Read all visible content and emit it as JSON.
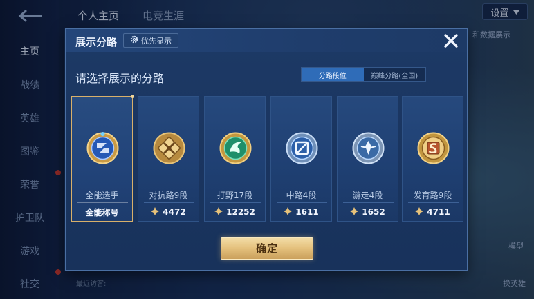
{
  "background": {
    "top_tabs": [
      "个人主页",
      "电竞生涯"
    ],
    "settings_label": "设置",
    "sidebar": [
      "主页",
      "战绩",
      "英雄",
      "图鉴",
      "荣誉",
      "护卫队",
      "游戏",
      "社交"
    ],
    "right_labels": [
      "模型",
      "换英雄"
    ],
    "bottom_label": "最近访客:",
    "partial_text": "和数据展示"
  },
  "modal": {
    "title": "展示分路",
    "priority_button": "优先显示",
    "subtitle": "请选择展示的分路",
    "tabs": [
      {
        "label": "分路段位",
        "active": true
      },
      {
        "label": "巅峰分路(全国)",
        "active": false
      }
    ],
    "cards": [
      {
        "rank": "全能选手",
        "value": "全能称号",
        "selected": true,
        "icon": "all-round-emblem"
      },
      {
        "rank": "对抗路9段",
        "value": "4472",
        "selected": false,
        "icon": "clash-lane-emblem"
      },
      {
        "rank": "打野17段",
        "value": "12252",
        "selected": false,
        "icon": "jungle-emblem"
      },
      {
        "rank": "中路4段",
        "value": "1611",
        "selected": false,
        "icon": "mid-lane-emblem"
      },
      {
        "rank": "游走4段",
        "value": "1652",
        "selected": false,
        "icon": "roam-emblem"
      },
      {
        "rank": "发育路9段",
        "value": "4711",
        "selected": false,
        "icon": "farm-lane-emblem"
      }
    ],
    "confirm_label": "确定"
  },
  "colors": {
    "accent_gold": "#e4c07c",
    "tab_active": "#2f6cb8",
    "modal_bg": "#1a3560"
  }
}
